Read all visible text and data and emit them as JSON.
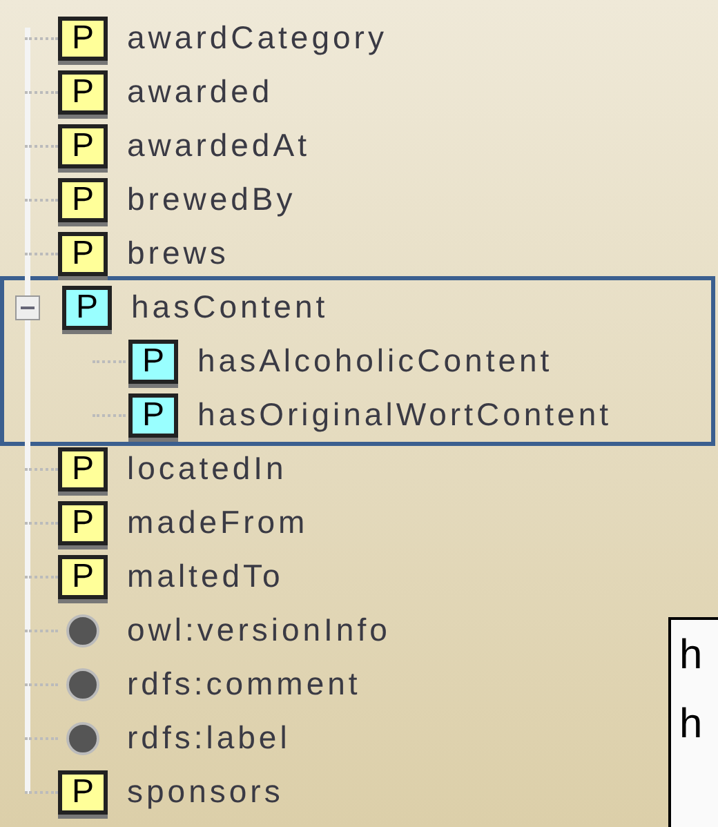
{
  "tree": {
    "items": [
      {
        "kind": "property",
        "icon": "P",
        "label": "awardCategory",
        "color": "#ffff99"
      },
      {
        "kind": "property",
        "icon": "P",
        "label": "awarded",
        "color": "#ffff99"
      },
      {
        "kind": "property",
        "icon": "P",
        "label": "awardedAt",
        "color": "#ffff99"
      },
      {
        "kind": "property",
        "icon": "P",
        "label": "brewedBy",
        "color": "#ffff99"
      },
      {
        "kind": "property",
        "icon": "P",
        "label": "brews",
        "color": "#ffff99"
      },
      {
        "kind": "property",
        "icon": "P",
        "label": "hasContent",
        "color": "#99ffff",
        "expanded": true,
        "highlighted": true,
        "children": [
          {
            "kind": "property",
            "icon": "P",
            "label": "hasAlcoholicContent",
            "color": "#99ffff"
          },
          {
            "kind": "property",
            "icon": "P",
            "label": "hasOriginalWortContent",
            "color": "#99ffff"
          }
        ]
      },
      {
        "kind": "property",
        "icon": "P",
        "label": "locatedIn",
        "color": "#ffff99"
      },
      {
        "kind": "property",
        "icon": "P",
        "label": "madeFrom",
        "color": "#ffff99"
      },
      {
        "kind": "property",
        "icon": "P",
        "label": "maltedTo",
        "color": "#ffff99"
      },
      {
        "kind": "annotation",
        "label": "owl:versionInfo"
      },
      {
        "kind": "annotation",
        "label": "rdfs:comment"
      },
      {
        "kind": "annotation",
        "label": "rdfs:label"
      },
      {
        "kind": "property",
        "icon": "P",
        "label": "sponsors",
        "color": "#ffff99"
      }
    ]
  },
  "callout": {
    "lines": [
      "h",
      "h"
    ]
  }
}
